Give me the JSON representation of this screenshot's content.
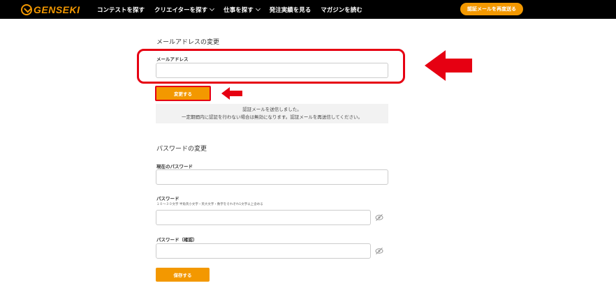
{
  "header": {
    "logo_text": "GENSEKI",
    "nav": [
      {
        "label": "コンテストを探す"
      },
      {
        "label": "クリエイターを探す",
        "has_dropdown": true
      },
      {
        "label": "仕事を探す",
        "has_dropdown": true
      },
      {
        "label": "発注実績を見る"
      },
      {
        "label": "マガジンを読む"
      }
    ],
    "resend_button_label": "認証メールを再度送る"
  },
  "email_section": {
    "title": "メールアドレスの変更",
    "email_label": "メールアドレス",
    "email_value": "",
    "change_button_label": "変更する",
    "notice_line1": "認証メールを送信しました。",
    "notice_line2": "一定期間内に認証を行わない場合は無効になります。認証メールを再送信してください。"
  },
  "password_section": {
    "title": "パスワードの変更",
    "current_label": "現在のパスワード",
    "new_label": "パスワード",
    "new_hint": "１０～３０文字 半角英小文字・英大文字・数字をそれぞれ1文字以上含める",
    "confirm_label": "パスワード（確認）",
    "save_button_label": "保存する"
  },
  "colors": {
    "accent": "#f39800",
    "annotation_red": "#e60012",
    "header_bg": "#000000"
  },
  "icons": {
    "eye_hidden": "eye-off-icon",
    "annotation_arrow": "arrow-left-icon"
  }
}
